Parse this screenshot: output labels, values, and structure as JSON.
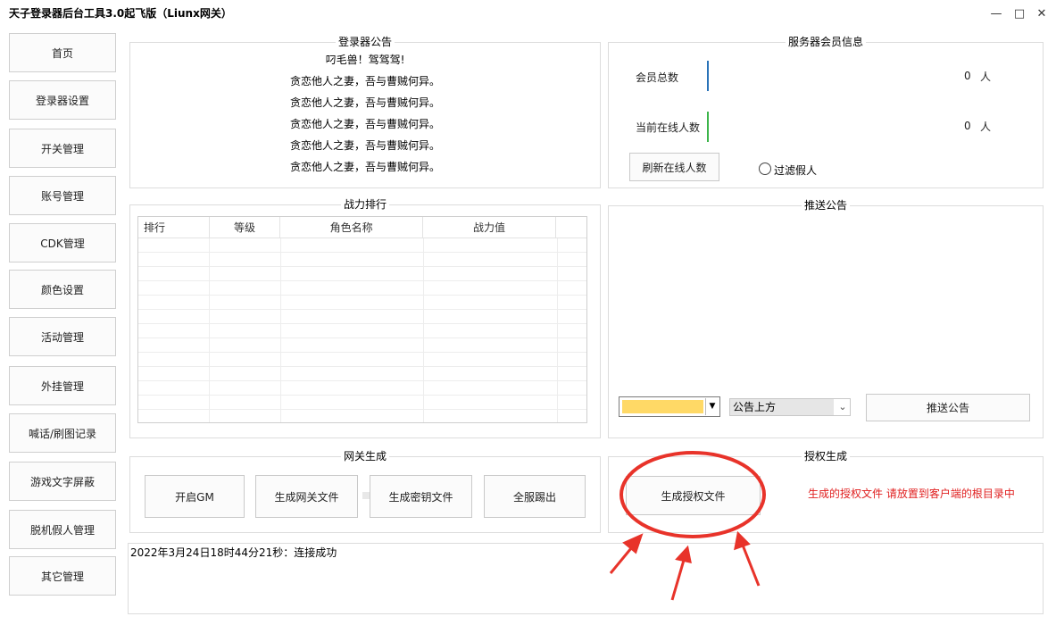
{
  "window": {
    "title": "天子登录器后台工具3.0起飞版（Liunx网关）",
    "minimize_label": "—",
    "maximize_label": "□",
    "close_label": "✕"
  },
  "nav": {
    "items": [
      {
        "label": "首页"
      },
      {
        "label": "登录器设置"
      },
      {
        "label": "开关管理"
      },
      {
        "label": "账号管理"
      },
      {
        "label": "CDK管理"
      },
      {
        "label": "颜色设置"
      },
      {
        "label": "活动管理"
      },
      {
        "label": "外挂管理"
      },
      {
        "label": "喊话/刷图记录"
      },
      {
        "label": "游戏文字屏蔽"
      },
      {
        "label": "脱机假人管理"
      },
      {
        "label": "其它管理"
      }
    ]
  },
  "notice": {
    "title": "登录器公告",
    "lines": [
      "叼毛兽！驾驾驾!",
      "贪恋他人之妻，吾与曹贼何异。",
      "贪恋他人之妻，吾与曹贼何异。",
      "贪恋他人之妻，吾与曹贼何异。",
      "贪恋他人之妻，吾与曹贼何异。",
      "贪恋他人之妻，吾与曹贼何异。"
    ]
  },
  "server_info": {
    "title": "服务器会员信息",
    "total_label": "会员总数",
    "total_value": "0",
    "total_unit": "人",
    "online_label": "当前在线人数",
    "online_value": "0",
    "online_unit": "人",
    "refresh_label": "刷新在线人数",
    "filter_label": "过滤假人"
  },
  "ranking": {
    "title": "战力排行",
    "columns": [
      "排行",
      "等级",
      "角色名称",
      "战力值"
    ]
  },
  "push": {
    "title": "推送公告",
    "color_value": "#ffd966",
    "position_value": "公告上方",
    "push_label": "推送公告"
  },
  "gateway": {
    "title": "网关生成",
    "open_gm": "开启GM",
    "gen_gateway": "生成网关文件",
    "gen_key": "生成密钥文件",
    "kick_all": "全服踢出"
  },
  "auth": {
    "title": "授权生成",
    "gen_auth": "生成授权文件",
    "hint": "生成的授权文件 请放置到客户端的根目录中",
    "hint_color": "#e02020"
  },
  "log": {
    "text": "2022年3月24日18时44分21秒：连接成功"
  },
  "annotation": {
    "color": "#e8332a"
  }
}
